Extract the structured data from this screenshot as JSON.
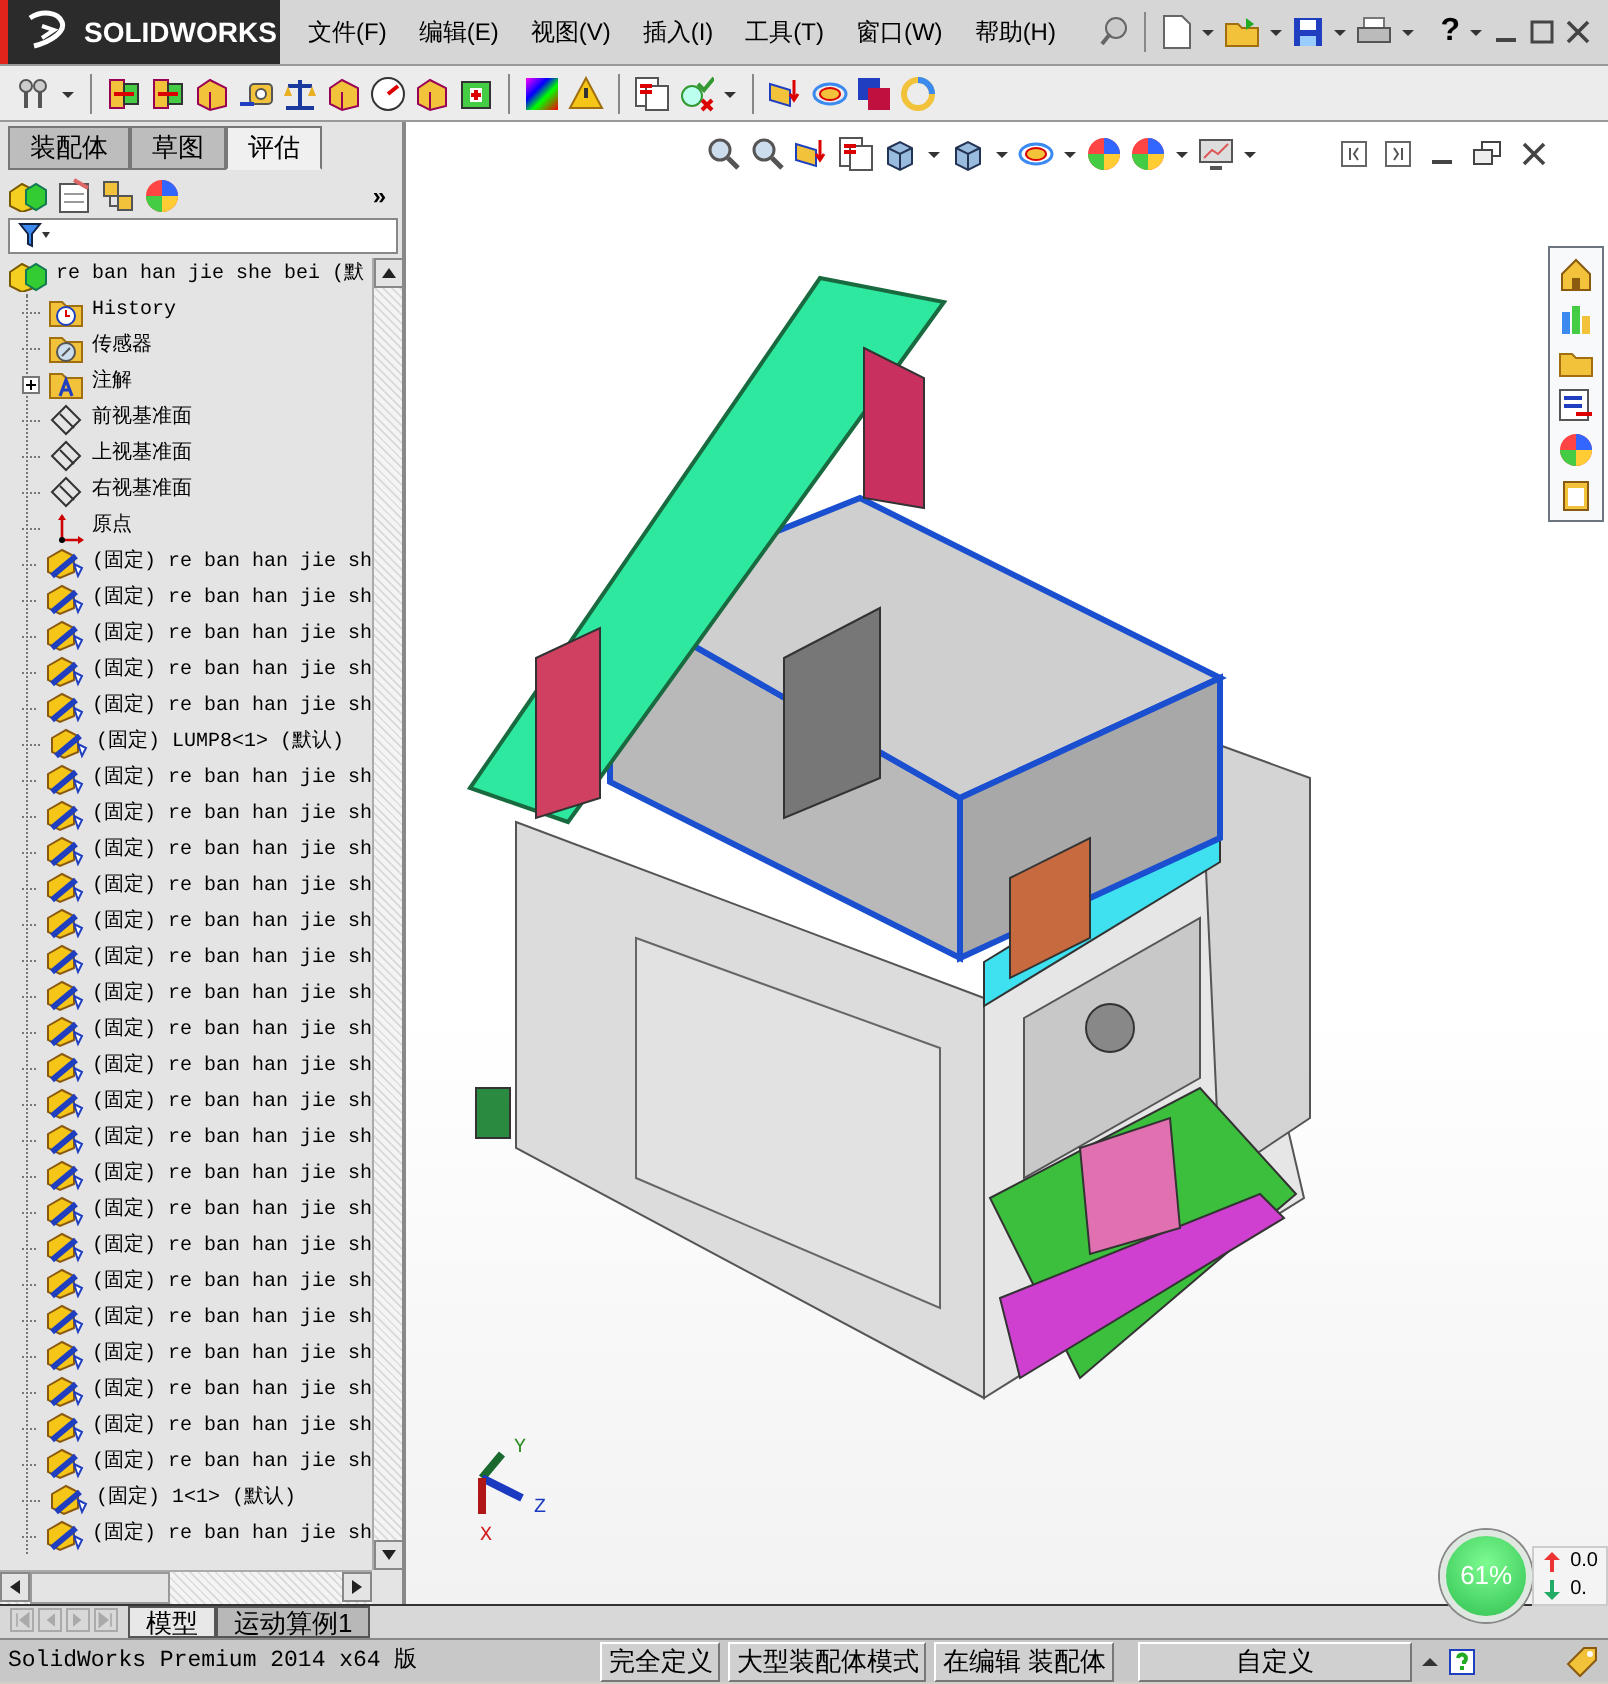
{
  "title_bar": {
    "logo": "SOLIDWORKS",
    "menus": [
      "文件(F)",
      "编辑(E)",
      "视图(V)",
      "插入(I)",
      "工具(T)",
      "窗口(W)",
      "帮助(H)"
    ],
    "help": "?"
  },
  "panel_tabs": [
    {
      "label": "装配体",
      "selected": false
    },
    {
      "label": "草图",
      "selected": false
    },
    {
      "label": "评估",
      "selected": true
    }
  ],
  "panel_more": "»",
  "tree": {
    "label": "re ban han jie she bei  (默",
    "children": [
      {
        "kind": "history",
        "label": "History"
      },
      {
        "kind": "sensor",
        "label": "传感器"
      },
      {
        "kind": "annotation",
        "label": "注解",
        "expanded": false
      },
      {
        "kind": "plane",
        "label": "前视基准面"
      },
      {
        "kind": "plane",
        "label": "上视基准面"
      },
      {
        "kind": "plane",
        "label": "右视基准面"
      },
      {
        "kind": "origin",
        "label": "原点"
      },
      {
        "kind": "component",
        "label": "(固定) re ban han jie sh"
      },
      {
        "kind": "component",
        "label": "(固定) re ban han jie sh"
      },
      {
        "kind": "component",
        "label": "(固定) re ban han jie sh"
      },
      {
        "kind": "component",
        "label": "(固定) re ban han jie sh"
      },
      {
        "kind": "component",
        "label": "(固定) re ban han jie sh"
      },
      {
        "kind": "component",
        "label": "(固定) LUMP8<1> (默认)"
      },
      {
        "kind": "component",
        "label": "(固定) re ban han jie sh"
      },
      {
        "kind": "component",
        "label": "(固定) re ban han jie sh"
      },
      {
        "kind": "component",
        "label": "(固定) re ban han jie sh"
      },
      {
        "kind": "component",
        "label": "(固定) re ban han jie sh"
      },
      {
        "kind": "component",
        "label": "(固定) re ban han jie sh"
      },
      {
        "kind": "component",
        "label": "(固定) re ban han jie sh"
      },
      {
        "kind": "component",
        "label": "(固定) re ban han jie sh"
      },
      {
        "kind": "component",
        "label": "(固定) re ban han jie sh"
      },
      {
        "kind": "component",
        "label": "(固定) re ban han jie sh"
      },
      {
        "kind": "component",
        "label": "(固定) re ban han jie sh"
      },
      {
        "kind": "component",
        "label": "(固定) re ban han jie sh"
      },
      {
        "kind": "component",
        "label": "(固定) re ban han jie sh"
      },
      {
        "kind": "component",
        "label": "(固定) re ban han jie sh"
      },
      {
        "kind": "component",
        "label": "(固定) re ban han jie sh"
      },
      {
        "kind": "component",
        "label": "(固定) re ban han jie sh"
      },
      {
        "kind": "component",
        "label": "(固定) re ban han jie sh"
      },
      {
        "kind": "component",
        "label": "(固定) re ban han jie sh"
      },
      {
        "kind": "component",
        "label": "(固定) re ban han jie sh"
      },
      {
        "kind": "component",
        "label": "(固定) re ban han jie sh"
      },
      {
        "kind": "component",
        "label": "(固定) re ban han jie sh"
      },
      {
        "kind": "component",
        "label": "(固定) 1<1> (默认)"
      },
      {
        "kind": "component",
        "label": "(固定) re ban han jie sh"
      }
    ]
  },
  "triad": {
    "y": "Y",
    "z": "Z",
    "x": "X"
  },
  "performance": {
    "percent": "61%",
    "up": "0.0",
    "down": "0."
  },
  "bottom_tabs": [
    {
      "label": "模型",
      "selected": true
    },
    {
      "label": "运动算例1",
      "selected": false
    }
  ],
  "status_bar": {
    "product": "SolidWorks Premium 2014 x64 版",
    "cells": [
      "完全定义",
      "大型装配体模式",
      "在编辑 装配体"
    ],
    "units": "自定义"
  }
}
